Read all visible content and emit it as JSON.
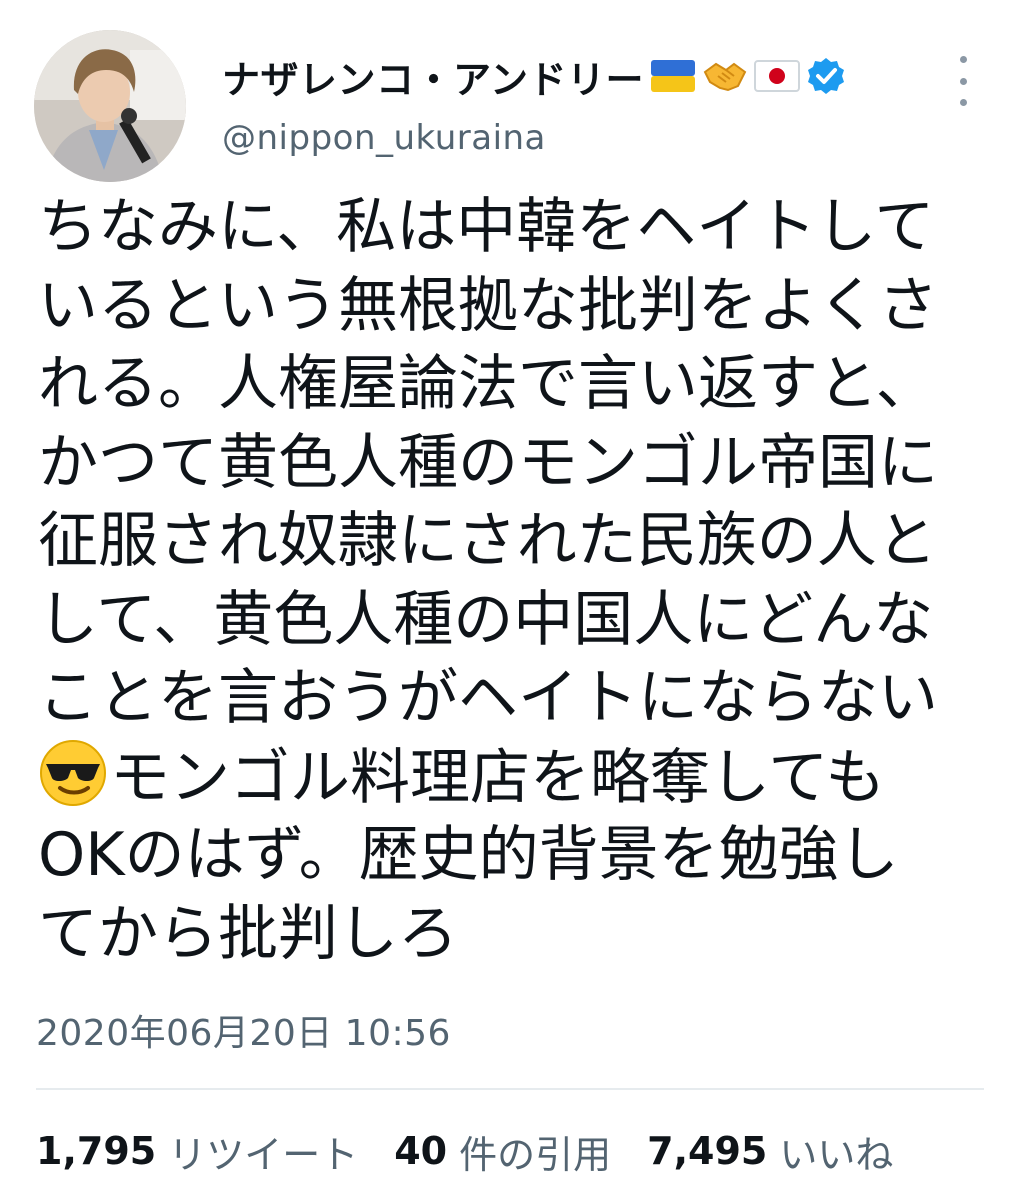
{
  "user": {
    "display_name": "ナザレンコ・アンドリー",
    "handle": "@nippon_ukuraina",
    "name_emojis": [
      "ukraine-flag",
      "handshake",
      "japan-flag"
    ],
    "verified": true
  },
  "tweet": {
    "lines": [
      "ちなみに、私は中韓をヘイトして",
      "いるという無根拠な批判をよくさ",
      "れる。人権屋論法で言い返すと、",
      "かつて黄色人種のモンゴル帝国に",
      "征服され奴隷にされた民族の人と",
      "して、黄色人種の中国人にどんな",
      "ことを言おうがヘイトにならない",
      "モンゴル料理店を略奪しても",
      "OKのはず。歴史的背景を勉強し",
      "てから批判しろ"
    ],
    "inline_emoji_line_index": 7,
    "inline_emoji": "sunglasses-face",
    "timestamp": "2020年06月20日 10:56"
  },
  "stats": {
    "retweets": {
      "count": "1,795",
      "label": "リツイート"
    },
    "quotes": {
      "count": "40",
      "label": "件の引用"
    },
    "likes": {
      "count": "7,495",
      "label": "いいね"
    }
  },
  "colors": {
    "text": "#0f1419",
    "secondary_text": "#536471",
    "verified_blue": "#1d9bf0",
    "divider": "#e6ebee"
  }
}
